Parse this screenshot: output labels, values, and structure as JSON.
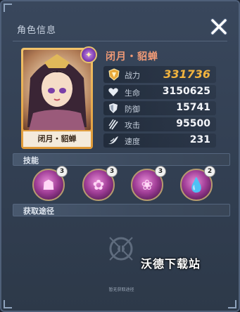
{
  "panel": {
    "title": "角色信息"
  },
  "hero": {
    "name": "闭月・貂蝉",
    "card_name": "闭月・貂蝉",
    "badge_icon": "star-badge-icon"
  },
  "stats": [
    {
      "icon": "crest-power-icon",
      "label": "战力",
      "value": "331736"
    },
    {
      "icon": "heart-icon",
      "label": "生命",
      "value": "3150625"
    },
    {
      "icon": "shield-icon",
      "label": "防御",
      "value": "15741"
    },
    {
      "icon": "claw-attack-icon",
      "label": "攻击",
      "value": "95500"
    },
    {
      "icon": "wing-speed-icon",
      "label": "速度",
      "value": "231"
    }
  ],
  "sections": {
    "skills": "技能",
    "source": "获取途径"
  },
  "skills": [
    {
      "icon": "spirit-skill-icon",
      "level": "3"
    },
    {
      "icon": "petal-burst-skill-icon",
      "level": "3"
    },
    {
      "icon": "lotus-skill-icon",
      "level": "3"
    },
    {
      "icon": "droplet-skill-icon",
      "level": "2"
    }
  ],
  "source": {
    "empty_text": "暂无获取途径"
  },
  "watermark": "沃德下载站",
  "colors": {
    "power_value": "#f2b43e",
    "hero_name": "#f09a76"
  }
}
